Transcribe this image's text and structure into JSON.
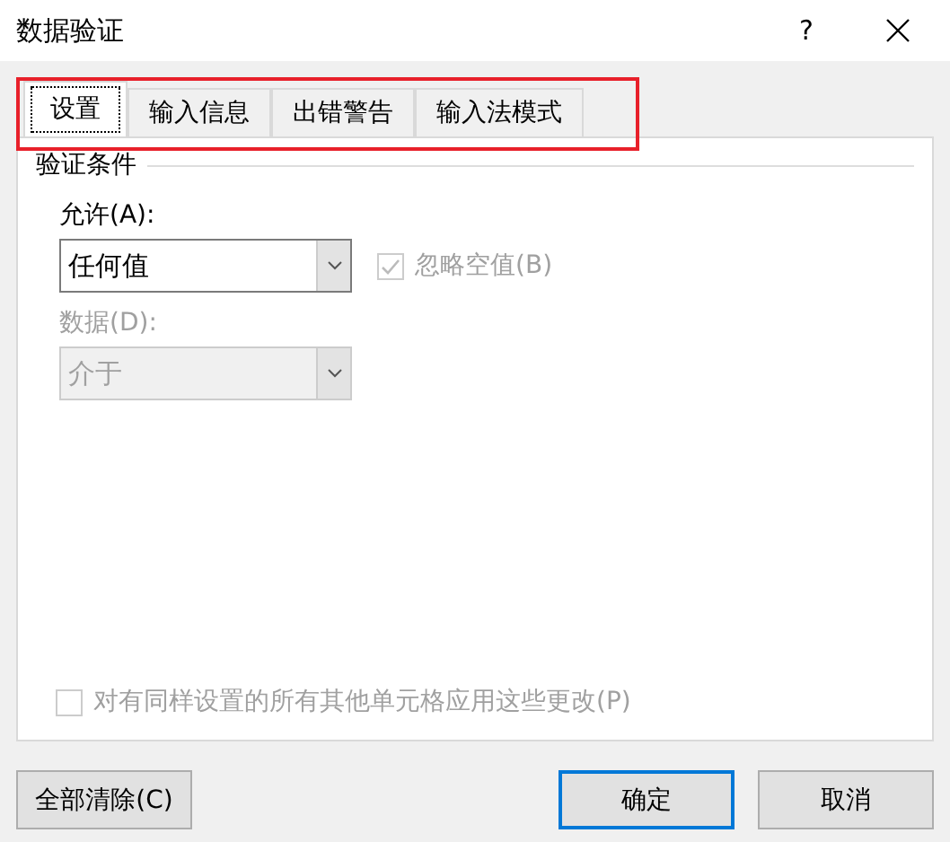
{
  "window": {
    "title": "数据验证",
    "help": "?"
  },
  "tabs": [
    {
      "label": "设置",
      "selected": true
    },
    {
      "label": "输入信息",
      "selected": false
    },
    {
      "label": "出错警告",
      "selected": false
    },
    {
      "label": "输入法模式",
      "selected": false
    }
  ],
  "group": {
    "title": "验证条件"
  },
  "allow": {
    "label": "允许(A):",
    "value": "任何值",
    "disabled": false
  },
  "ignore_blank": {
    "label": "忽略空值(B)",
    "checked": true,
    "disabled": true
  },
  "data": {
    "label": "数据(D):",
    "value": "介于",
    "disabled": true
  },
  "apply_all": {
    "label": "对有同样设置的所有其他单元格应用这些更改(P)",
    "checked": false,
    "disabled": true
  },
  "buttons": [
    {
      "label": "全部清除(C)",
      "kind": "clear",
      "focused": false
    },
    {
      "label": "确定",
      "kind": "ok",
      "focused": true
    },
    {
      "label": "取消",
      "kind": "cancel",
      "focused": false
    }
  ]
}
